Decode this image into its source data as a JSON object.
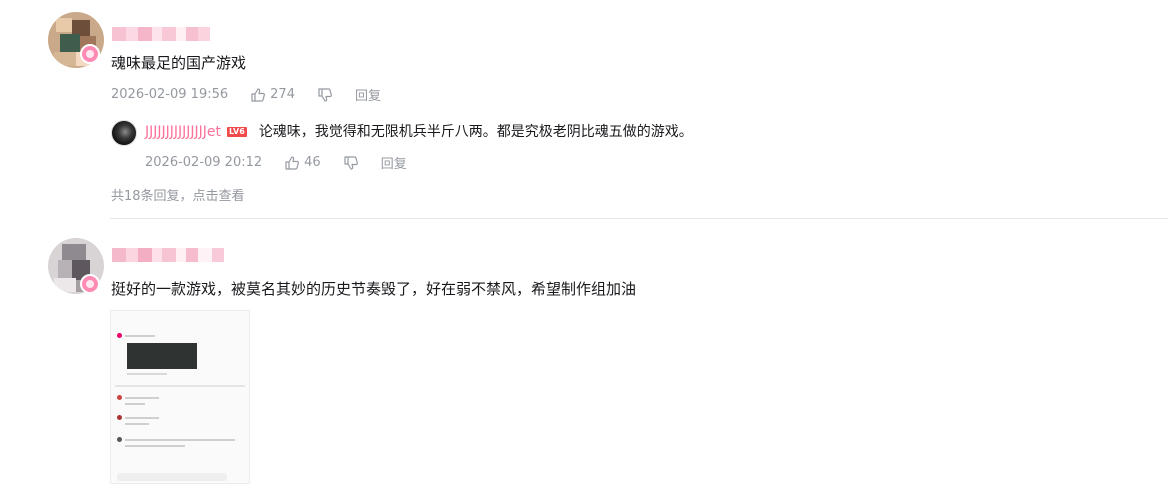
{
  "comments": [
    {
      "content": "魂味最足的国产游戏",
      "time": "2026-02-09 19:56",
      "likes": "274",
      "reply_label": "回复",
      "sub_reply": {
        "username": "JJJJJJJJJJJJJJJet",
        "level_badge": "LV6",
        "content": "论魂味，我觉得和无限机兵半斤八两。都是究极老阴比魂五做的游戏。",
        "time": "2026-02-09 20:12",
        "likes": "46",
        "reply_label": "回复"
      },
      "more_replies": {
        "prefix": "共18条回复，",
        "link": "点击查看"
      }
    },
    {
      "content": "挺好的一款游戏，被莫名其妙的历史节奏毁了，好在弱不禁风，希望制作组加油",
      "has_image": true
    }
  ],
  "icons": {
    "like": "thumbs-up-icon",
    "dislike": "thumbs-down-icon",
    "verified": "pink-badge-icon"
  },
  "colors": {
    "username_pink": "#fb7299",
    "meta_gray": "#9499a0",
    "divider": "#e3e5e7",
    "level_badge": "#f14a4a"
  }
}
